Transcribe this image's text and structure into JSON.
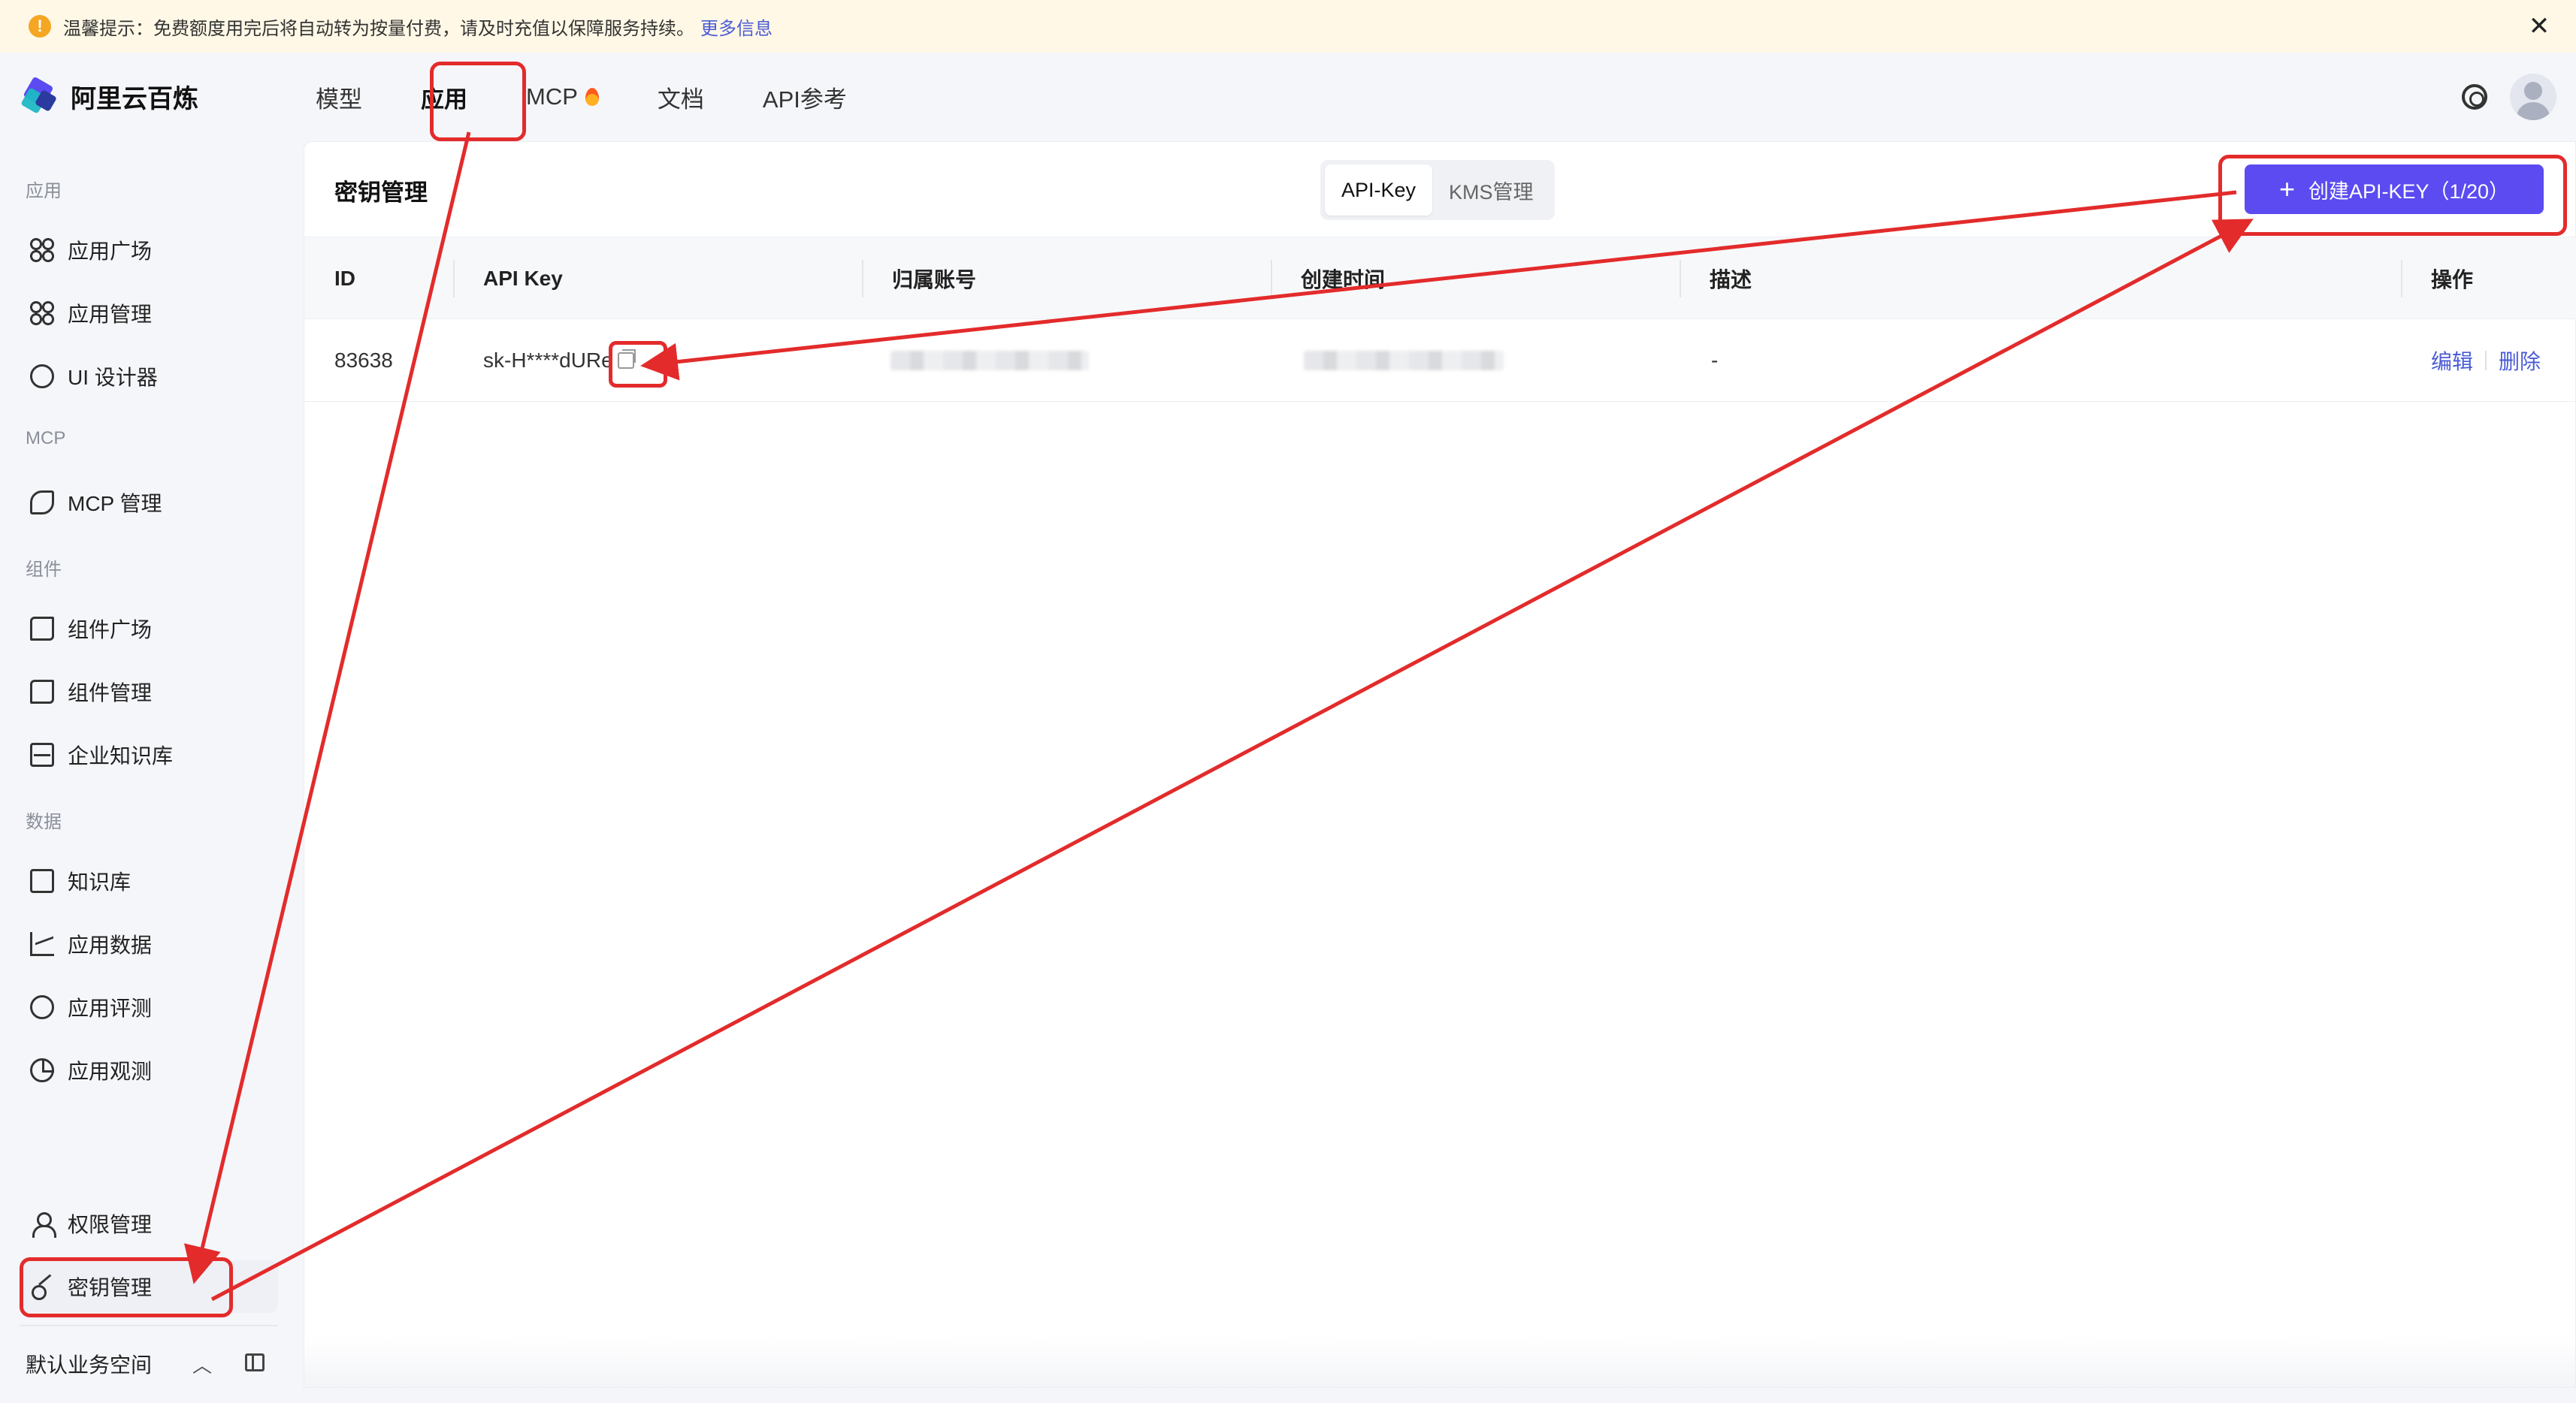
{
  "notice": {
    "text": "温馨提示：免费额度用完后将自动转为按量付费，请及时充值以保障服务持续。",
    "more_link": "更多信息",
    "warn_glyph": "!",
    "close_glyph": "✕"
  },
  "brand": {
    "name": "阿里云百炼"
  },
  "nav": {
    "tabs": [
      "模型",
      "应用",
      "MCP",
      "文档",
      "API参考"
    ],
    "active": "应用"
  },
  "sidebar": {
    "sections": [
      {
        "title": "应用",
        "items": [
          {
            "label": "应用广场",
            "icon": "grid-icon"
          },
          {
            "label": "应用管理",
            "icon": "grid-icon"
          },
          {
            "label": "UI 设计器",
            "icon": "palette-icon"
          }
        ]
      },
      {
        "title": "MCP",
        "items": [
          {
            "label": "MCP 管理",
            "icon": "mcp-icon"
          }
        ]
      },
      {
        "title": "组件",
        "items": [
          {
            "label": "组件广场",
            "icon": "puzzle-icon"
          },
          {
            "label": "组件管理",
            "icon": "puzzle-icon"
          },
          {
            "label": "企业知识库",
            "icon": "inbox-icon"
          }
        ]
      },
      {
        "title": "数据",
        "items": [
          {
            "label": "知识库",
            "icon": "book-icon"
          },
          {
            "label": "应用数据",
            "icon": "chart-icon"
          },
          {
            "label": "应用评测",
            "icon": "compass-icon"
          },
          {
            "label": "应用观测",
            "icon": "pie-icon"
          }
        ]
      }
    ],
    "bottom_items": [
      {
        "label": "权限管理",
        "icon": "user-icon"
      },
      {
        "label": "密钥管理",
        "icon": "key-icon",
        "active": true
      }
    ],
    "workspace": "默认业务空间",
    "workspace_chevron": "︿"
  },
  "main": {
    "title": "密钥管理",
    "segments": [
      "API-Key",
      "KMS管理"
    ],
    "active_segment": "API-Key",
    "create_button": "创建API-KEY（1/20）",
    "plus_glyph": "+",
    "table": {
      "columns": [
        "ID",
        "API Key",
        "归属账号",
        "创建时间",
        "描述",
        "操作"
      ],
      "rows": [
        {
          "id": "83638",
          "api_key": "sk-H****dURe",
          "account": "",
          "created": "",
          "description": "-",
          "actions": [
            "编辑",
            "删除"
          ]
        }
      ]
    }
  },
  "colors": {
    "accent": "#5b4bf1",
    "link": "#4b5bd6",
    "annotation": "#e32b2b",
    "notice_bg": "#fff8e6"
  }
}
